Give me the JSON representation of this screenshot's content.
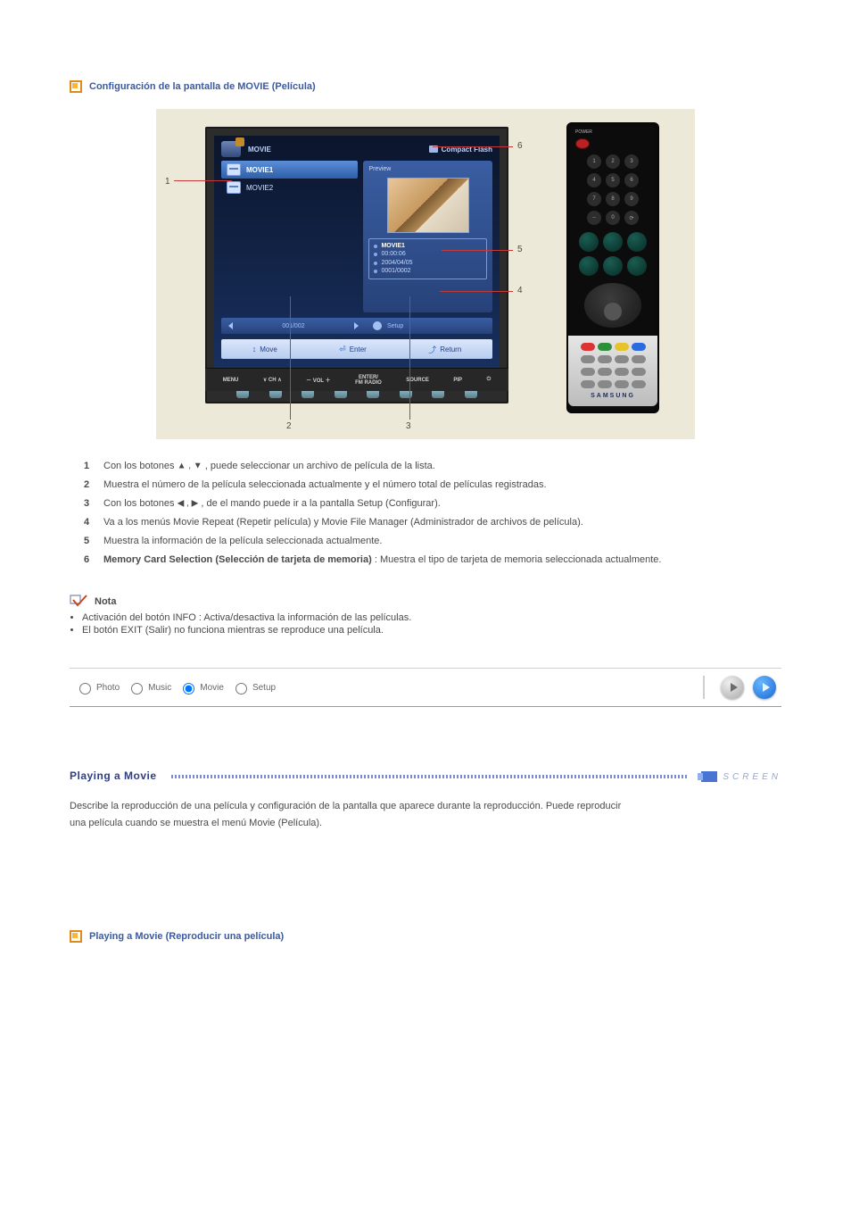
{
  "section1_title": "Configuración de la pantalla de MOVIE (Película)",
  "figure": {
    "osd": {
      "header_title": "MOVIE",
      "header_right": "Compact Flash",
      "list": [
        "MOVIE1",
        "MOVIE2"
      ],
      "preview_label": "Preview",
      "meta": {
        "name": "MOVIE1",
        "duration": "00:00:06",
        "date": "2004/04/05",
        "index": "0001/0002"
      },
      "pagebar_center": "001/002",
      "pagebar_right": "Setup",
      "help": {
        "move": "Move",
        "enter": "Enter",
        "return": "Return"
      }
    },
    "tv_buttons": [
      "MENU",
      "∨  CH  ∧",
      "－  VOL  ＋",
      "ENTER/\nFM RADIO",
      "SOURCE",
      "PIP",
      "⏻"
    ],
    "callout_numbers": [
      "1",
      "2",
      "3",
      "4",
      "5",
      "6"
    ],
    "remote": {
      "power_label": "POWER",
      "numpad": [
        "1",
        "2",
        "3",
        "4",
        "5",
        "6",
        "7",
        "8",
        "9",
        "–",
        "0",
        "⟳"
      ],
      "brand": "SAMSUNG"
    }
  },
  "list": [
    {
      "n": "1",
      "pre": "Con los botones ",
      "glyphs": "▲ , ▼",
      "post": ", puede seleccionar un archivo de película de la lista."
    },
    {
      "n": "2",
      "pre": "Muestra el número de la película seleccionada actualmente y el número total de películas registradas.",
      "glyphs": "",
      "post": ""
    },
    {
      "n": "3",
      "pre": "Con los botones ",
      "glyphs": "◀ , ▶",
      "post": ", de el mando puede ir a la pantalla Setup (Configurar)."
    },
    {
      "n": "4",
      "pre": "Va a los menús Movie Repeat (Repetir película) y Movie File Manager (Administrador de archivos de película).",
      "glyphs": "",
      "post": ""
    },
    {
      "n": "5",
      "pre": "Muestra la información de la película seleccionada actualmente.",
      "glyphs": "",
      "post": ""
    },
    {
      "n": "6",
      "pre": "",
      "glyphs": "Memory Card Selection (Selección de tarjeta de memoria) ",
      "post": ": Muestra el tipo de tarjeta de memoria seleccionada actualmente."
    }
  ],
  "note_label": "Nota",
  "notes": [
    "Activación del botón INFO : Activa/desactiva la información de las películas.",
    "El botón EXIT (Salir) no funciona mientras se reproduce una película."
  ],
  "options": [
    "Photo",
    "Music",
    "Movie",
    "Setup"
  ],
  "selected_option": 2,
  "section2_title": "Playing a Movie",
  "screen_label": "SCREEN",
  "section2_desc": "Describe la reproducción de una película y configuración de la pantalla que aparece durante la reproducción. Puede reproducir una película cuando se muestra el menú Movie (Película).",
  "section3_title": "Playing a Movie (Reproducir una película)"
}
